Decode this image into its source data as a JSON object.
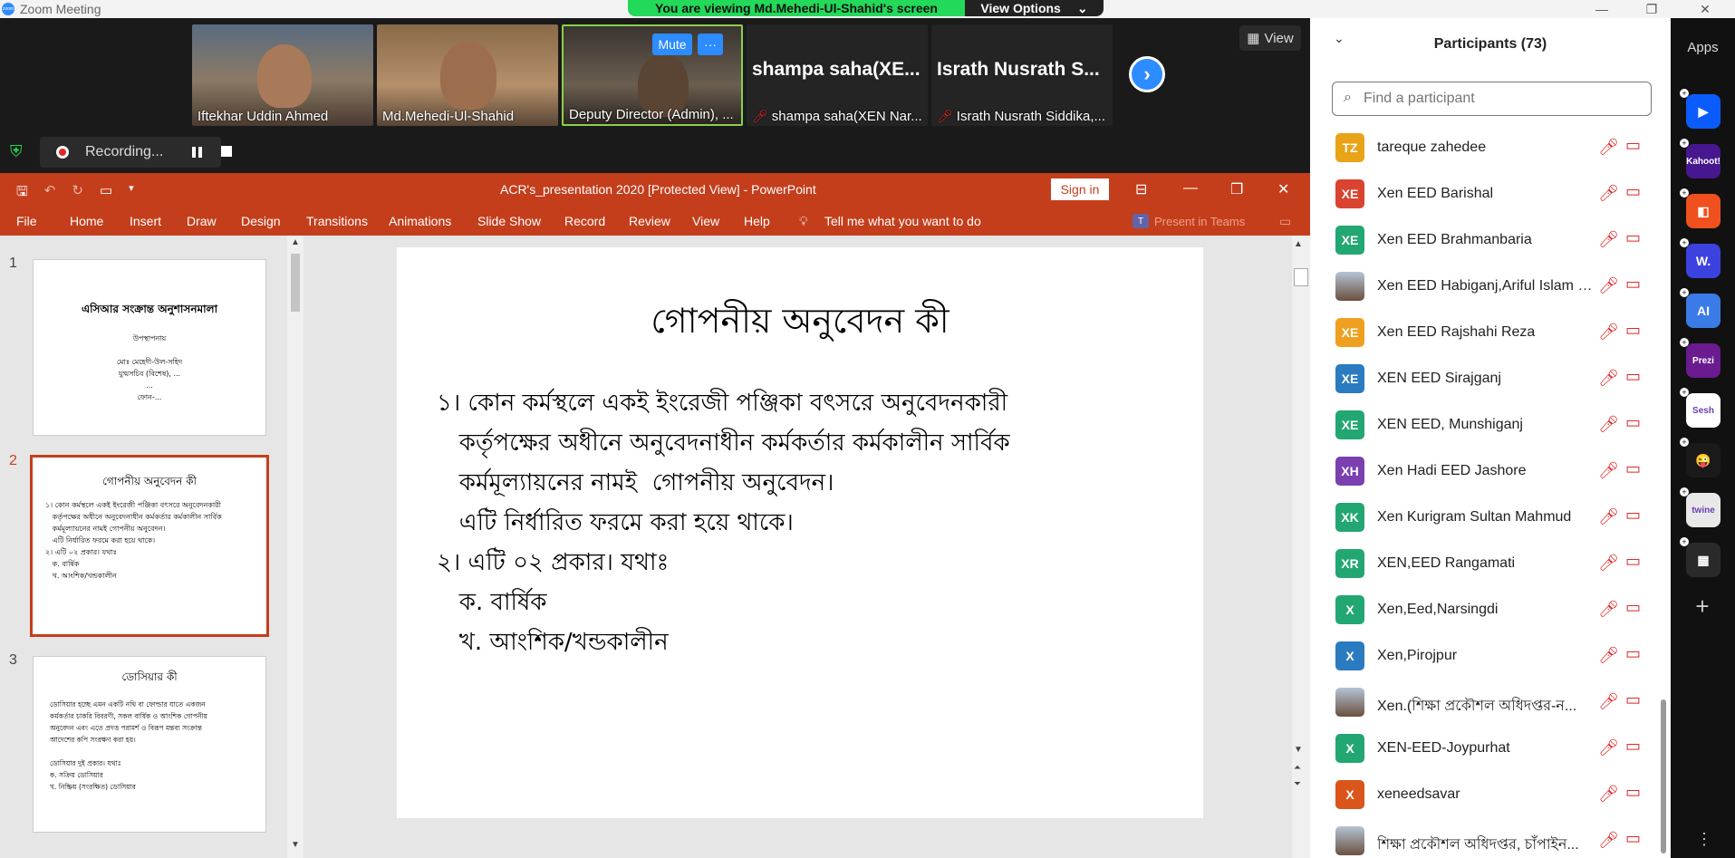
{
  "window": {
    "title": "Zoom Meeting",
    "viewing_banner": "You are viewing Md.Mehedi-Ul-Shahid's screen",
    "view_options": "View Options"
  },
  "videos": [
    {
      "name": "Iftekhar Uddin Ahmed",
      "kind": "photo"
    },
    {
      "name": "Md.Mehedi-Ul-Shahid",
      "kind": "photo"
    },
    {
      "name": "Deputy Director (Admin), ...",
      "kind": "photo",
      "mute_label": "Mute",
      "more_label": "···"
    },
    {
      "name": "shampa saha(XEN Nar...",
      "big": "shampa saha(XE...",
      "kind": "dark"
    },
    {
      "name": "Israth Nusrath Siddika,...",
      "big": "Israth Nusrath S...",
      "kind": "dark"
    }
  ],
  "view_button": "View",
  "recording": {
    "label": "Recording..."
  },
  "ppt": {
    "title": "ACR's_presentation 2020 [Protected View]  -  PowerPoint",
    "sign_in": "Sign in",
    "tabs": [
      "File",
      "Home",
      "Insert",
      "Draw",
      "Design",
      "Transitions",
      "Animations",
      "Slide Show",
      "Record",
      "Review",
      "View",
      "Help"
    ],
    "tell_me": "Tell me what you want to do",
    "present_in_teams": "Present in Teams",
    "thumbnails": [
      {
        "num": "1",
        "title": "এসিআর সংক্রান্ত অনুশাসনমালা",
        "lines": "উপস্থাপনায়\n\nমোঃ মেহেদী-উল-সহিদ\nযুগ্মসচিব (বিশেষ), ...\n...\nফোন-..."
      },
      {
        "num": "2",
        "title": "গোপনীয় অনুবেদন কী",
        "lines": "১। কোন কর্মস্থলে একই ইংরেজী পঞ্জিকা বৎসরে অনুবেদনকারী\n   কর্তৃপক্ষের অধীনে অনুবেদনাধীন কর্মকর্তার কর্মকালীন সার্বিক\n   কর্মমূল্যায়নের নামই গোপনীয় অনুবেদন।\n   এটি নির্ধারিত ফরমে করা হয়ে থাকে।\n২। এটি ০২ প্রকার। যথাঃ\n   ক. বার্ষিক\n   খ. আংশিক/খন্ডকালীন"
      },
      {
        "num": "3",
        "title": "ডোসিয়ার কী",
        "lines": "ডোসিয়ার হচ্ছে এমন একটি নথি বা ফোল্ডার যাতে একজন\nকর্মকর্তার চাকরি বিবরণী, সকল বার্ষিক ও আংশিক গোপনীয়\nঅনুবেদন এবং এতে প্রদত্ত পরামর্শ ও বিরূপ মন্তব্য সংক্রান্ত\nআদেশের কপি সংরক্ষণ করা হয়।\n\nডোসিয়ার দুই প্রকার। যথাঃ\nক. সক্রিয় ডোসিয়ার\nখ. নিষ্ক্রিয় (সংরক্ষিত) ডোসিয়ার"
      }
    ],
    "slide": {
      "title": "গোপনীয় অনুবেদন কী",
      "body": "১। কোন কর্মস্থলে একই ইংরেজী পঞ্জিকা বৎসরে অনুবেদনকারী\n   কর্তৃপক্ষের অধীনে অনুবেদনাধীন কর্মকর্তার কর্মকালীন সার্বিক\n   কর্মমূল্যায়নের নামই  গোপনীয় অনুবেদন।\n   এটি নির্ধারিত ফরমে করা হয়ে থাকে।\n২। এটি ০২ প্রকার। যথাঃ\n   ক. বার্ষিক\n   খ. আংশিক/খন্ডকালীন"
    }
  },
  "participants": {
    "title": "Participants (73)",
    "search_placeholder": "Find a participant",
    "list": [
      {
        "initials": "TZ",
        "color": "#e8a317",
        "name": "tareque zahedee"
      },
      {
        "initials": "XE",
        "color": "#d9432f",
        "name": "Xen EED Barishal"
      },
      {
        "initials": "XE",
        "color": "#23a772",
        "name": "Xen EED Brahmanbaria"
      },
      {
        "initials": "",
        "color": "photo",
        "name": "Xen EED Habiganj,Ariful Islam Kh..."
      },
      {
        "initials": "XE",
        "color": "#f0a020",
        "name": "Xen EED Rajshahi Reza"
      },
      {
        "initials": "XE",
        "color": "#2a7bbf",
        "name": "XEN EED Sirajganj"
      },
      {
        "initials": "XE",
        "color": "#23a772",
        "name": "XEN EED, Munshiganj"
      },
      {
        "initials": "XH",
        "color": "#7b3fb0",
        "name": "Xen Hadi EED Jashore"
      },
      {
        "initials": "XK",
        "color": "#23a772",
        "name": "Xen Kurigram Sultan Mahmud"
      },
      {
        "initials": "XR",
        "color": "#23a772",
        "name": "XEN,EED Rangamati"
      },
      {
        "initials": "X",
        "color": "#23a772",
        "name": "Xen,Eed,Narsingdi"
      },
      {
        "initials": "X",
        "color": "#2a7bbf",
        "name": "Xen,Pirojpur"
      },
      {
        "initials": "",
        "color": "photo",
        "name": "Xen.(শিক্ষা প্রকৌশল অধিদপ্তর-ন..."
      },
      {
        "initials": "X",
        "color": "#23a772",
        "name": "XEN-EED-Joypurhat"
      },
      {
        "initials": "X",
        "color": "#d9551a",
        "name": "xeneedsavar"
      },
      {
        "initials": "",
        "color": "photo",
        "name": "শিক্ষা প্রকৌশল অধিদপ্তর, চাঁপাইন..."
      }
    ]
  },
  "apps": {
    "label": "Apps",
    "items": [
      {
        "name": "zoom-app",
        "color": "#0b5cff",
        "text": "▶"
      },
      {
        "name": "kahoot-app",
        "color": "#46178f",
        "text": "Kahoot!"
      },
      {
        "name": "orange-app",
        "color": "#f0501e",
        "text": "◧"
      },
      {
        "name": "wooclap-app",
        "color": "#3b42e0",
        "text": "W."
      },
      {
        "name": "ai-app",
        "color": "#3b7be8",
        "text": "AI"
      },
      {
        "name": "prezi-app",
        "color": "#6a1b8f",
        "text": "Prezi"
      },
      {
        "name": "sesh-app",
        "color": "#ffffff",
        "text": "Sesh"
      },
      {
        "name": "emoji-app",
        "color": "#1a1a1a",
        "text": "😜"
      },
      {
        "name": "twine-app",
        "color": "#e8e8e8",
        "text": "twine"
      },
      {
        "name": "grid-app",
        "color": "#2a2a2a",
        "text": "▦"
      }
    ]
  }
}
